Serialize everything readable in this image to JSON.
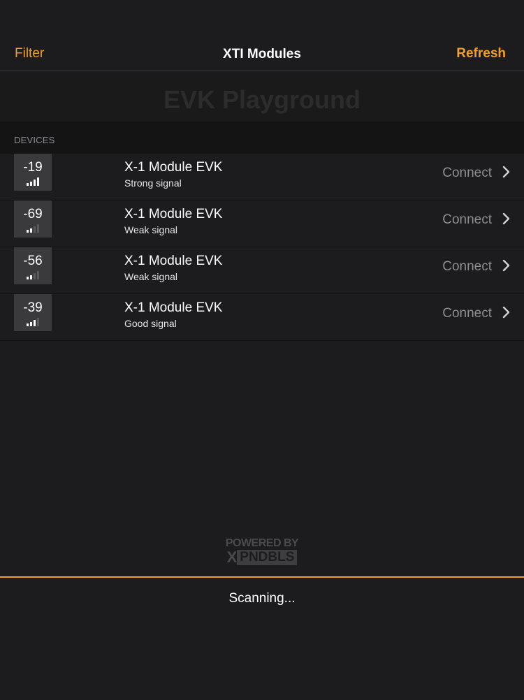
{
  "nav": {
    "left_label": "Filter",
    "title": "XTI Modules",
    "right_label": "Refresh"
  },
  "banner": {
    "title": "EVK Playground"
  },
  "section": {
    "header": "DEVICES"
  },
  "devices": [
    {
      "rssi": "-19",
      "name": "X-1 Module EVK",
      "signal": "Strong signal",
      "signal_bars": 4,
      "action": "Connect"
    },
    {
      "rssi": "-69",
      "name": "X-1 Module EVK",
      "signal": "Weak signal",
      "signal_bars": 2,
      "action": "Connect"
    },
    {
      "rssi": "-56",
      "name": "X-1 Module EVK",
      "signal": "Weak signal",
      "signal_bars": 2,
      "action": "Connect"
    },
    {
      "rssi": "-39",
      "name": "X-1 Module EVK",
      "signal": "Good signal",
      "signal_bars": 3,
      "action": "Connect"
    }
  ],
  "footer": {
    "powered_by": "POWERED BY",
    "logo_x": "X",
    "logo_text": "PNDBLS"
  },
  "status": {
    "text": "Scanning..."
  },
  "colors": {
    "accent": "#f0a028",
    "background": "#1c1c1e"
  },
  "icons": {
    "chevron": "chevron-right-icon",
    "signal": "signal-bars-icon"
  }
}
